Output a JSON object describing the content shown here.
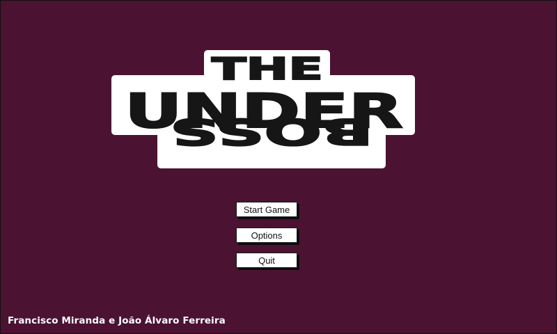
{
  "colors": {
    "background": "#4b1232",
    "logo_fill": "#161616",
    "logo_outline": "#ffffff",
    "button_bg": "#ffffff",
    "button_text": "#111111",
    "credits_text": "#ffffff"
  },
  "logo": {
    "line1": "THE",
    "line2": "UNDER",
    "line3": "BOSS",
    "line3_flipped": true
  },
  "menu": {
    "start_label": "Start Game",
    "options_label": "Options",
    "quit_label": "Quit"
  },
  "credits": "Francisco Miranda e João Álvaro Ferreira"
}
